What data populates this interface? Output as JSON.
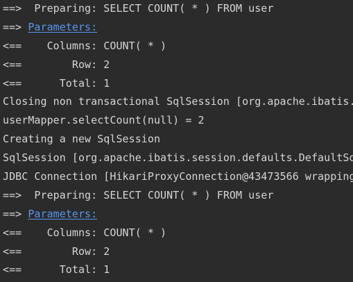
{
  "console": {
    "lines": [
      {
        "text": "==>  Preparing: SELECT COUNT( * ) FROM user"
      },
      {
        "prefix": "==> ",
        "link": "Parameters:"
      },
      {
        "text": "<==    Columns: COUNT( * )"
      },
      {
        "text": "<==        Row: 2"
      },
      {
        "text": "<==      Total: 1"
      },
      {
        "text": "Closing non transactional SqlSession [org.apache.ibatis.session.defaults.DefaultSqlSession"
      },
      {
        "text": "userMapper.selectCount(null) = 2"
      },
      {
        "text": "Creating a new SqlSession"
      },
      {
        "text": "SqlSession [org.apache.ibatis.session.defaults.DefaultSqlSession"
      },
      {
        "text": "JDBC Connection [HikariProxyConnection@43473566 wrapping"
      },
      {
        "text": "==>  Preparing: SELECT COUNT( * ) FROM user"
      },
      {
        "prefix": "==> ",
        "link": "Parameters:"
      },
      {
        "text": "<==    Columns: COUNT( * )"
      },
      {
        "text": "<==        Row: 2"
      },
      {
        "text": "<==      Total: 1"
      }
    ]
  },
  "colors": {
    "background": "#2b2b2b",
    "text": "#d6d6d6",
    "link": "#5896f0"
  }
}
